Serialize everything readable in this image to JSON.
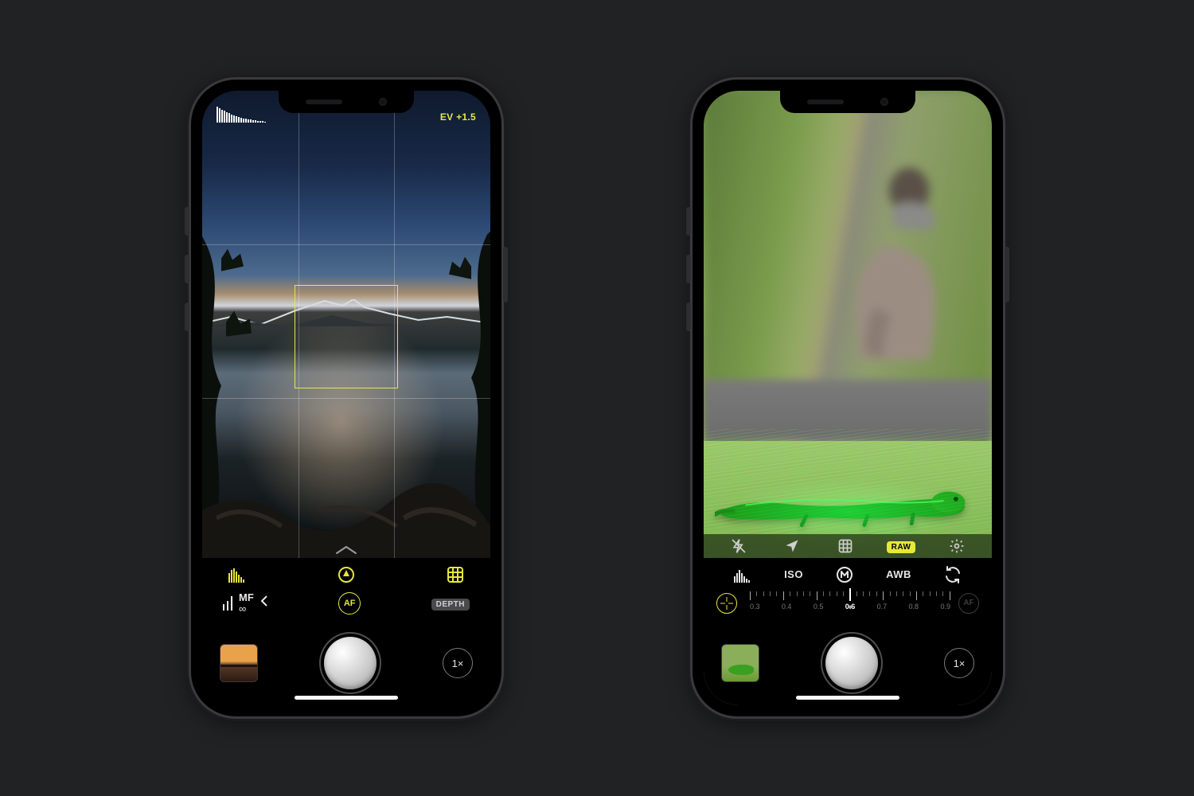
{
  "colors": {
    "accent": "#e6e83a"
  },
  "phone1": {
    "ev_label": "EV +1.5",
    "row1": {
      "histogram_icon": "histogram-icon",
      "peaking_icon": "focus-peaking-icon",
      "grid_icon": "grid-icon"
    },
    "focus_row": {
      "mf_label": "MF",
      "infinity": "∞",
      "af_label": "AF",
      "depth_label": "DEPTH"
    },
    "zoom_label": "1×"
  },
  "phone2": {
    "tool_row": {
      "flash_off_icon": "flash-off-icon",
      "location_icon": "location-icon",
      "grid_icon": "grid-icon",
      "raw_label": "RAW",
      "settings_icon": "settings-icon"
    },
    "row1": {
      "histogram_icon": "histogram-icon",
      "iso_label": "ISO",
      "manual_icon": "manual-mode-icon",
      "awb_label": "AWB",
      "swap_icon": "camera-swap-icon"
    },
    "scale": {
      "labels": [
        "0.3",
        "0.4",
        "0.5",
        "0.6",
        "0.7",
        "0.8",
        "0.9"
      ],
      "current": "0.6",
      "af_label": "AF"
    },
    "zoom_label": "1×"
  }
}
